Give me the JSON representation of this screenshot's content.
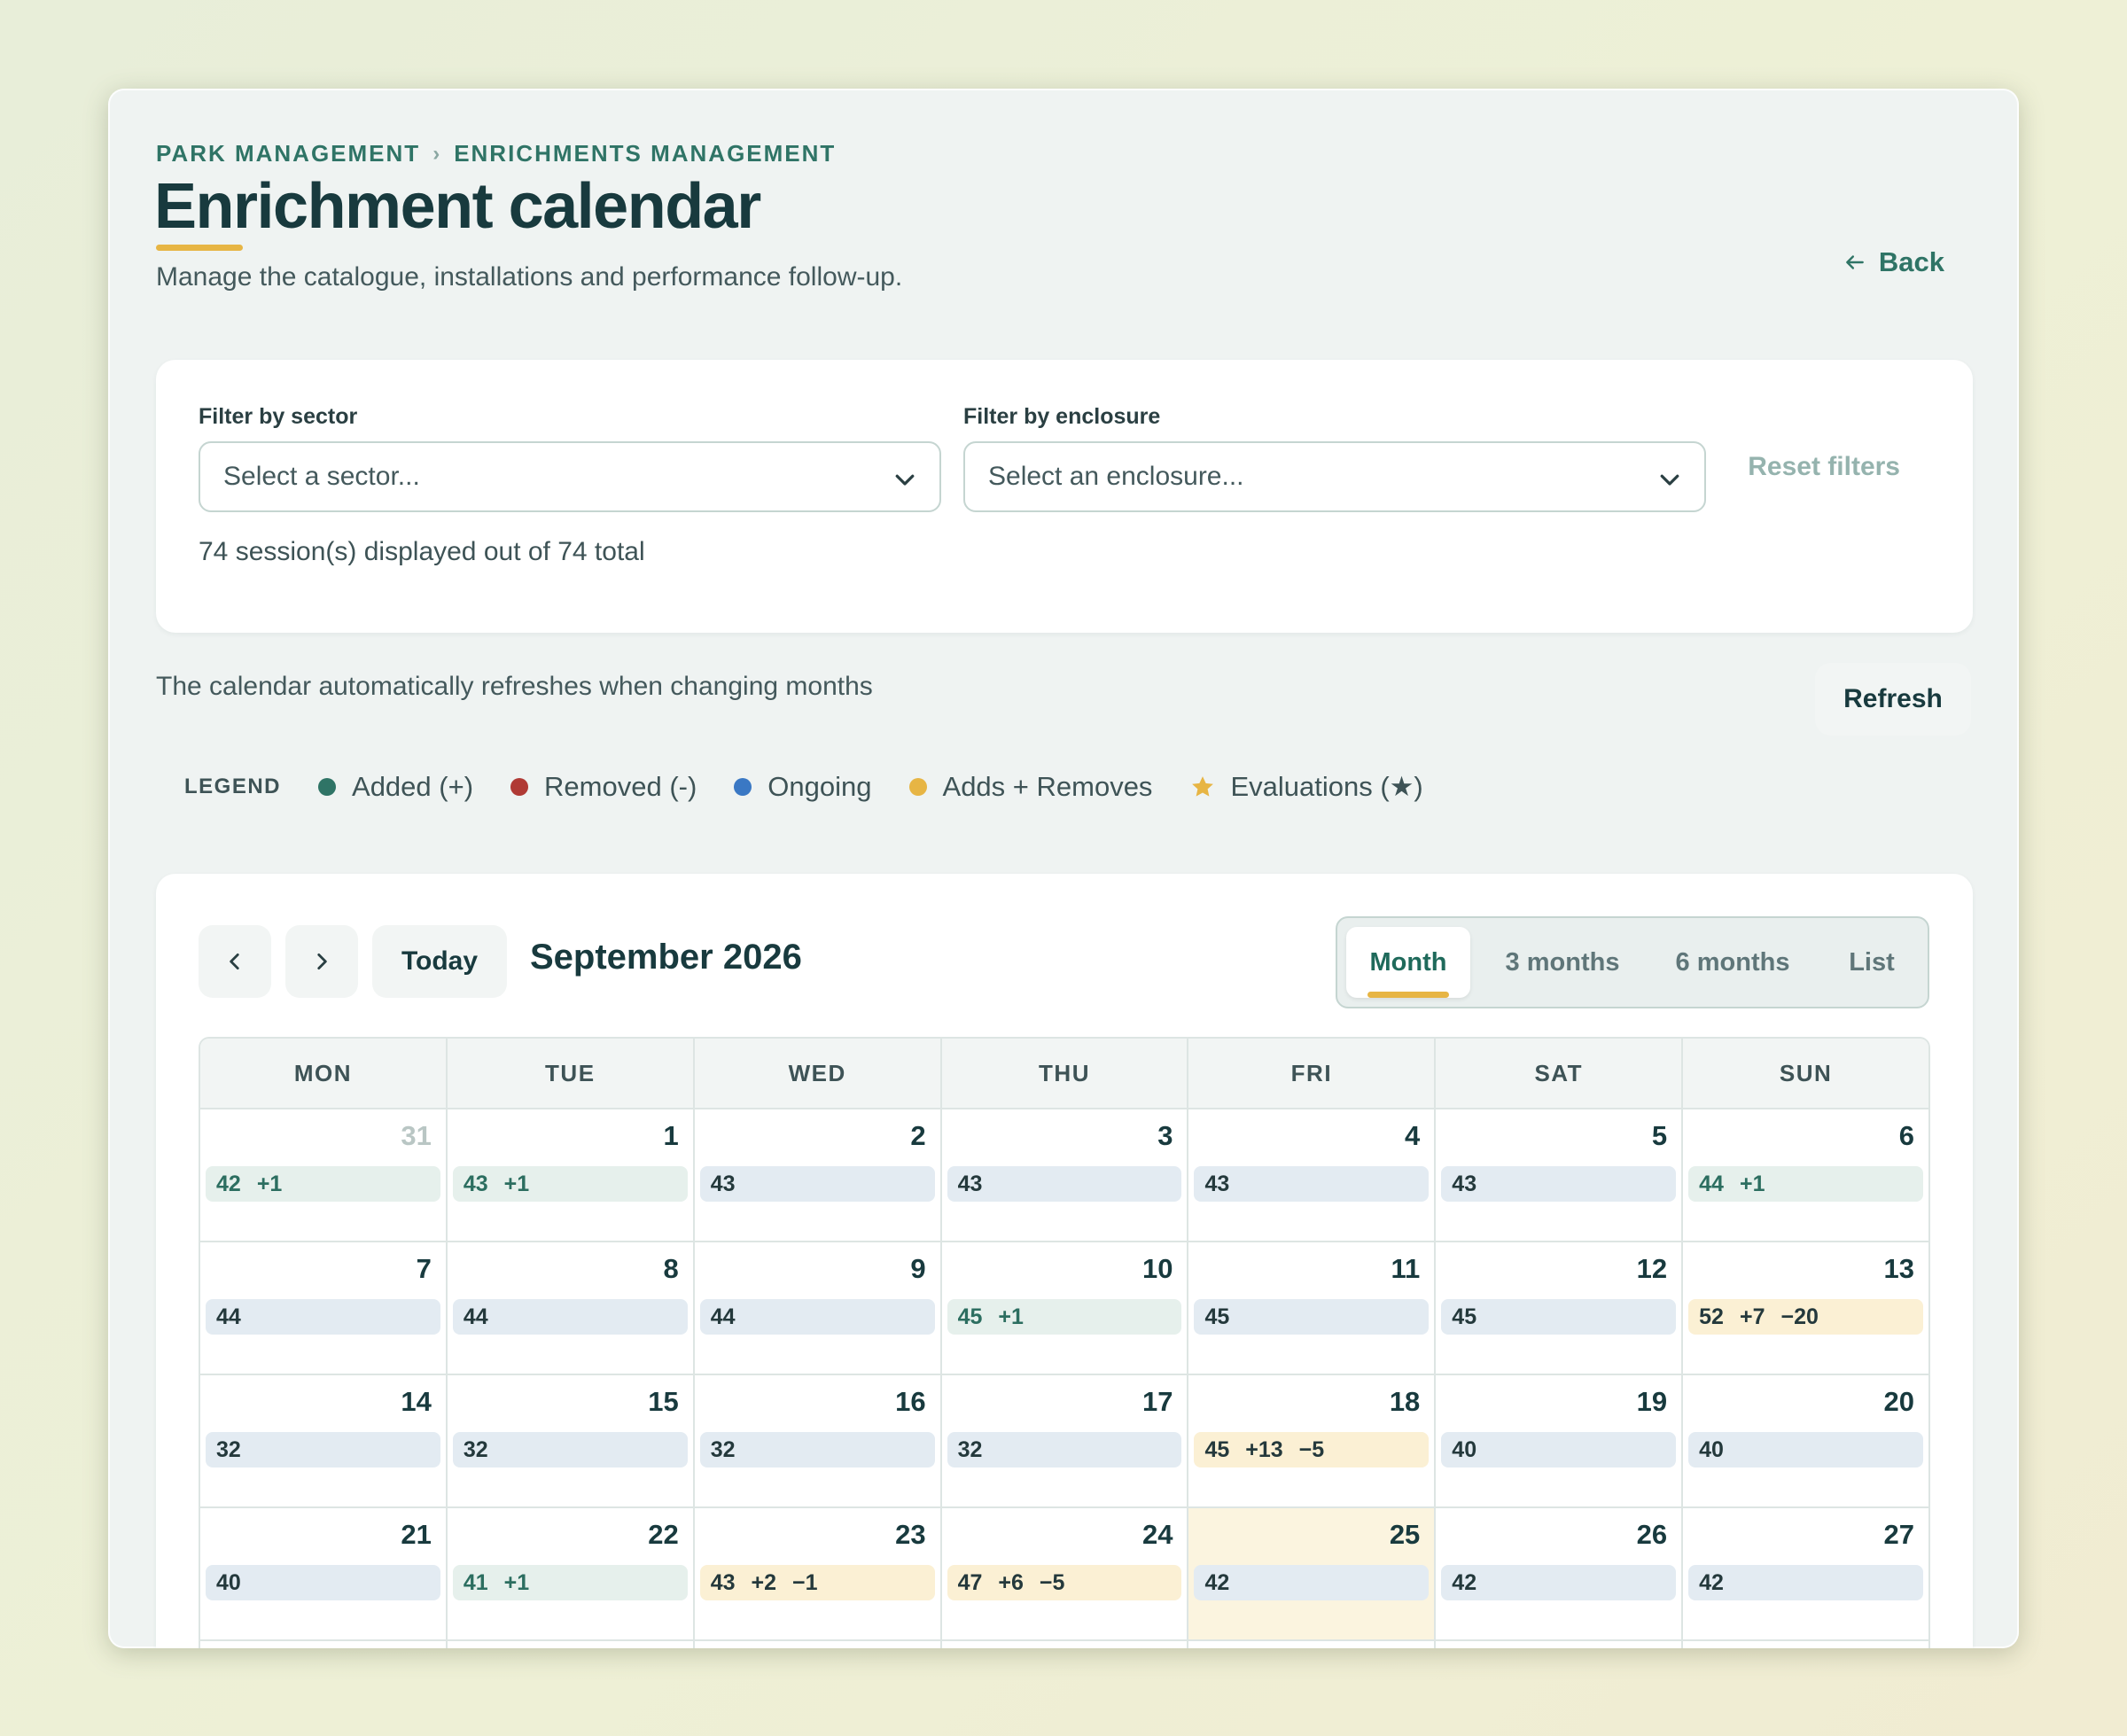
{
  "breadcrumb": [
    "PARK MANAGEMENT",
    "ENRICHMENTS MANAGEMENT"
  ],
  "breadcrumb_separator": "›",
  "header": {
    "title": "Enrichment calendar",
    "subtitle": "Manage the catalogue, installations and performance follow-up.",
    "back_label": "Back"
  },
  "filters": {
    "sector_label": "Filter by sector",
    "sector_placeholder": "Select a sector...",
    "enclosure_label": "Filter by enclosure",
    "enclosure_placeholder": "Select an enclosure...",
    "reset_label": "Reset filters",
    "count_text": "74 session(s) displayed out of 74 total"
  },
  "refresh": {
    "note": "The calendar automatically refreshes when changing months",
    "button_label": "Refresh"
  },
  "legend": {
    "title": "LEGEND",
    "items": [
      {
        "label": "Added (+)",
        "color": "#2f7466",
        "icon": "dot"
      },
      {
        "label": "Removed (-)",
        "color": "#b03a35",
        "icon": "dot"
      },
      {
        "label": "Ongoing",
        "color": "#3a78c4",
        "icon": "dot"
      },
      {
        "label": "Adds + Removes",
        "color": "#e7b544",
        "icon": "dot"
      },
      {
        "label": "Evaluations (★)",
        "color": "#e7b544",
        "icon": "star-icon"
      }
    ]
  },
  "calendar": {
    "month_title": "September 2026",
    "today_label": "Today",
    "views": [
      {
        "label": "Month",
        "active": true
      },
      {
        "label": "3 months",
        "active": false
      },
      {
        "label": "6 months",
        "active": false
      },
      {
        "label": "List",
        "active": false
      }
    ],
    "weekdays": [
      "MON",
      "TUE",
      "WED",
      "THU",
      "FRI",
      "SAT",
      "SUN"
    ],
    "weeks": [
      [
        {
          "day": "31",
          "outside": true,
          "count": "42",
          "added": "+1",
          "removed": "",
          "type": "added"
        },
        {
          "day": "1",
          "count": "43",
          "added": "+1",
          "removed": "",
          "type": "added"
        },
        {
          "day": "2",
          "count": "43",
          "added": "",
          "removed": "",
          "type": "ongoing"
        },
        {
          "day": "3",
          "count": "43",
          "added": "",
          "removed": "",
          "type": "ongoing"
        },
        {
          "day": "4",
          "count": "43",
          "added": "",
          "removed": "",
          "type": "ongoing"
        },
        {
          "day": "5",
          "count": "43",
          "added": "",
          "removed": "",
          "type": "ongoing"
        },
        {
          "day": "6",
          "count": "44",
          "added": "+1",
          "removed": "",
          "type": "added"
        }
      ],
      [
        {
          "day": "7",
          "count": "44",
          "added": "",
          "removed": "",
          "type": "ongoing"
        },
        {
          "day": "8",
          "count": "44",
          "added": "",
          "removed": "",
          "type": "ongoing"
        },
        {
          "day": "9",
          "count": "44",
          "added": "",
          "removed": "",
          "type": "ongoing"
        },
        {
          "day": "10",
          "count": "45",
          "added": "+1",
          "removed": "",
          "type": "added"
        },
        {
          "day": "11",
          "count": "45",
          "added": "",
          "removed": "",
          "type": "ongoing"
        },
        {
          "day": "12",
          "count": "45",
          "added": "",
          "removed": "",
          "type": "ongoing"
        },
        {
          "day": "13",
          "count": "52",
          "added": "+7",
          "removed": "−20",
          "type": "mixed"
        }
      ],
      [
        {
          "day": "14",
          "count": "32",
          "added": "",
          "removed": "",
          "type": "ongoing"
        },
        {
          "day": "15",
          "count": "32",
          "added": "",
          "removed": "",
          "type": "ongoing"
        },
        {
          "day": "16",
          "count": "32",
          "added": "",
          "removed": "",
          "type": "ongoing"
        },
        {
          "day": "17",
          "count": "32",
          "added": "",
          "removed": "",
          "type": "ongoing"
        },
        {
          "day": "18",
          "count": "45",
          "added": "+13",
          "removed": "−5",
          "type": "mixed"
        },
        {
          "day": "19",
          "count": "40",
          "added": "",
          "removed": "",
          "type": "ongoing"
        },
        {
          "day": "20",
          "count": "40",
          "added": "",
          "removed": "",
          "type": "ongoing"
        }
      ],
      [
        {
          "day": "21",
          "count": "40",
          "added": "",
          "removed": "",
          "type": "ongoing"
        },
        {
          "day": "22",
          "count": "41",
          "added": "+1",
          "removed": "",
          "type": "added"
        },
        {
          "day": "23",
          "count": "43",
          "added": "+2",
          "removed": "−1",
          "type": "mixed"
        },
        {
          "day": "24",
          "count": "47",
          "added": "+6",
          "removed": "−5",
          "type": "mixed"
        },
        {
          "day": "25",
          "today": true,
          "count": "42",
          "added": "",
          "removed": "",
          "type": "ongoing"
        },
        {
          "day": "26",
          "count": "42",
          "added": "",
          "removed": "",
          "type": "ongoing"
        },
        {
          "day": "27",
          "count": "42",
          "added": "",
          "removed": "",
          "type": "ongoing"
        }
      ]
    ]
  }
}
